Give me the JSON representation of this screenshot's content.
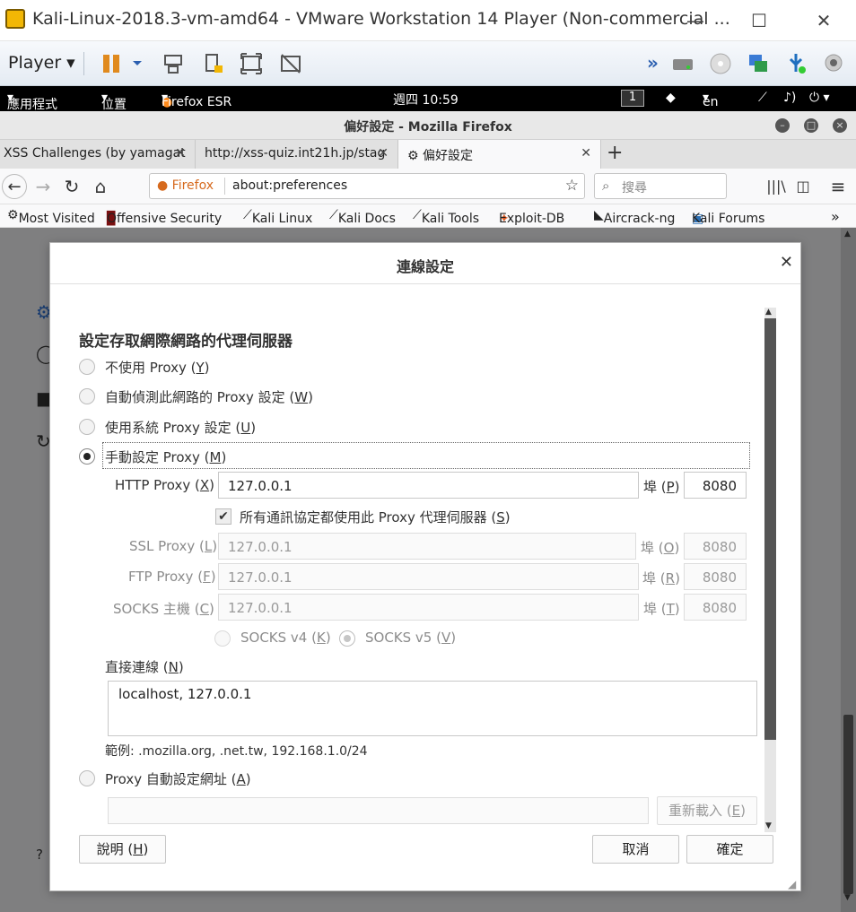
{
  "vmware": {
    "title": "Kali-Linux-2018.3-vm-amd64 - VMware Workstation 14 Player (Non-commercial ...",
    "player_label": "Player",
    "window_controls": [
      "minimize-icon",
      "maximize-icon",
      "close-icon"
    ]
  },
  "kali_panel": {
    "apps": "應用程式",
    "places": "位置",
    "firefox": "Firefox ESR",
    "clock": "週四 10:59",
    "workspace": "1",
    "lang": "en"
  },
  "firefox": {
    "window_title": "偏好設定 - Mozilla Firefox",
    "tabs": [
      {
        "label": "XSS Challenges (by yamagat"
      },
      {
        "label": "http://xss-quiz.int21h.jp/stag"
      },
      {
        "label": "偏好設定"
      }
    ],
    "urlbar": {
      "brand": "Firefox",
      "url": "about:preferences"
    },
    "search_placeholder": "搜尋",
    "bookmarks": [
      "Most Visited",
      "Offensive Security",
      "Kali Linux",
      "Kali Docs",
      "Kali Tools",
      "Exploit-DB",
      "Aircrack-ng",
      "Kali Forums"
    ]
  },
  "dialog": {
    "title": "連線設定",
    "section_title": "設定存取網際網路的代理伺服器",
    "options": {
      "no_proxy": {
        "text": "不使用 Proxy (",
        "key": "Y",
        "end": ")"
      },
      "auto_detect": {
        "text": "自動偵測此網路的 Proxy 設定 (",
        "key": "W",
        "end": ")"
      },
      "system": {
        "text": "使用系統 Proxy 設定 (",
        "key": "U",
        "end": ")"
      },
      "manual": {
        "text": "手動設定 Proxy (",
        "key": "M",
        "end": ")"
      },
      "pac": {
        "text": "Proxy 自動設定網址 (",
        "key": "A",
        "end": ")"
      }
    },
    "selected_option": "manual",
    "http": {
      "label": "HTTP Proxy (",
      "key": "X",
      "end": ")",
      "value": "127.0.0.1",
      "port_label": "埠 (",
      "port_key": "P",
      "port": "8080"
    },
    "same_for_all": {
      "label": "所有通訊協定都使用此 Proxy 代理伺服器 (",
      "key": "S",
      "end": ")",
      "checked": true
    },
    "ssl": {
      "label": "SSL Proxy (",
      "key": "L",
      "end": ")",
      "value": "127.0.0.1",
      "port_label": "埠 (",
      "port_key": "O",
      "port": "8080"
    },
    "ftp": {
      "label": "FTP Proxy (",
      "key": "F",
      "end": ")",
      "value": "127.0.0.1",
      "port_label": "埠 (",
      "port_key": "R",
      "port": "8080"
    },
    "socks": {
      "label": "SOCKS 主機 (",
      "key": "C",
      "end": ")",
      "value": "127.0.0.1",
      "port_label": "埠 (",
      "port_key": "T",
      "port": "8080"
    },
    "socks_v4": {
      "label": "SOCKS v4 (",
      "key": "K",
      "end": ")"
    },
    "socks_v5": {
      "label": "SOCKS v5 (",
      "key": "V",
      "end": ")"
    },
    "no_proxy_for": {
      "label": "直接連線 (",
      "key": "N",
      "end": ")",
      "value": "localhost, 127.0.0.1"
    },
    "example": "範例: .mozilla.org, .net.tw, 192.168.1.0/24",
    "pac_url": "",
    "reload_button": {
      "text": "重新載入 (",
      "key": "E",
      "end": ")"
    },
    "help_button": {
      "text": "說明 (",
      "key": "H",
      "end": ")"
    },
    "cancel_button": "取消",
    "ok_button": "確定"
  }
}
